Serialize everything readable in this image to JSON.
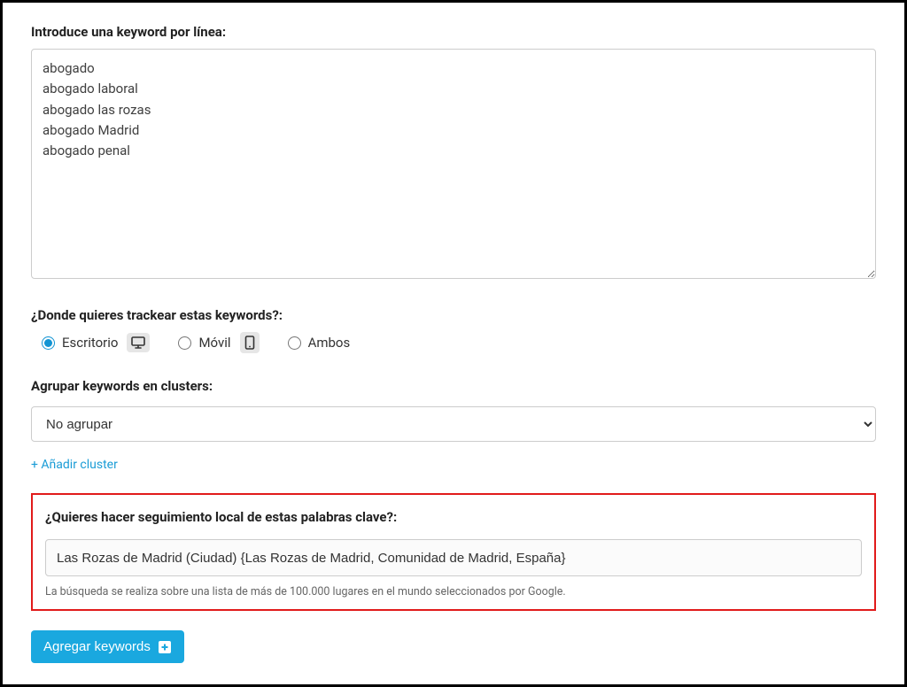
{
  "keywords_section": {
    "label": "Introduce una keyword por línea:",
    "value": "abogado\nabogado laboral\nabogado las rozas\nabogado Madrid\nabogado penal"
  },
  "tracking_section": {
    "label": "¿Donde quieres trackear estas keywords?:",
    "options": {
      "desktop": "Escritorio",
      "mobile": "Móvil",
      "both": "Ambos"
    }
  },
  "cluster_section": {
    "label": "Agrupar keywords en clusters:",
    "selected": "No agrupar",
    "add_link": "+ Añadir cluster"
  },
  "local_section": {
    "label": "¿Quieres hacer seguimiento local de estas palabras clave?:",
    "value": "Las Rozas de Madrid (Ciudad) {Las Rozas de Madrid, Comunidad de Madrid, España}",
    "help": "La búsqueda se realiza sobre una lista de más de 100.000 lugares en el mundo seleccionados por Google."
  },
  "submit": {
    "label": "Agregar keywords"
  }
}
